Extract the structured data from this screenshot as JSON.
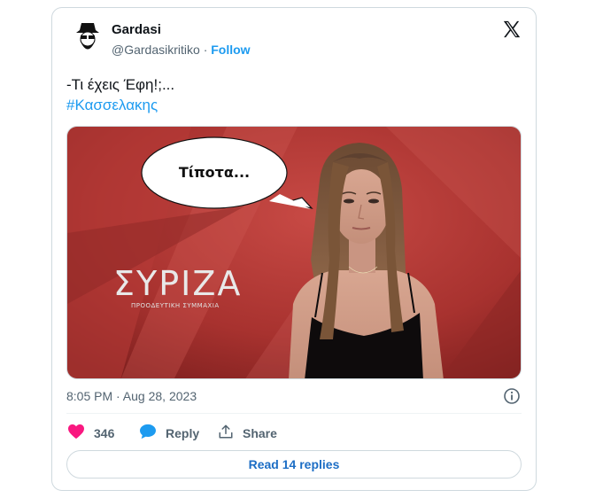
{
  "author": {
    "name": "Gardasi",
    "handle": "@Gardasikritiko",
    "separator": "·",
    "follow_label": "Follow"
  },
  "tweet": {
    "line1": "-Τι έχεις Έφη!;...",
    "hashtag": "#Κασσελακης"
  },
  "media": {
    "bubble_text": "Τίποτα...",
    "logo_text": "ΣΥΡΙΖΑ",
    "logo_subtitle": "ΠΡΟΟΔΕΥΤΙΚΗ ΣΥΜΜΑΧΙΑ"
  },
  "meta": {
    "timestamp": "8:05 PM · Aug 28, 2023"
  },
  "actions": {
    "like_count": "346",
    "reply_label": "Reply",
    "share_label": "Share"
  },
  "read_replies_label": "Read 14 replies",
  "colors": {
    "accent": "#1d9bf0",
    "like": "#f91880",
    "muted": "#536471",
    "border": "#cfd9de"
  },
  "icons": [
    "avatar-illustration",
    "x-logo-icon",
    "info-icon",
    "heart-icon",
    "reply-bubble-icon",
    "share-icon"
  ]
}
